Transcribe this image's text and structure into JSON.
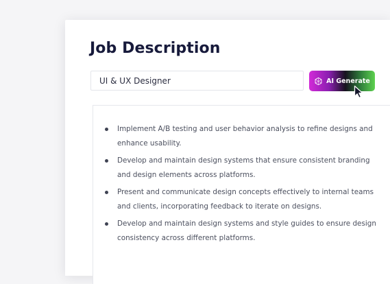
{
  "page": {
    "title": "Job Description"
  },
  "job_title_input": {
    "value": "UI & UX Designer"
  },
  "ai_button": {
    "label": "AI Generate",
    "icon": "openai-icon"
  },
  "cursor": {
    "icon": "mouse-pointer-icon"
  },
  "description": {
    "bullets": [
      "Implement A/B testing and user behavior analysis to refine designs and enhance usability.",
      "Develop and maintain design systems that ensure consistent branding and design elements across platforms.",
      "Present and communicate design concepts effectively to internal teams and clients, incorporating feedback to iterate on designs.",
      "Develop and maintain design systems and style guides to ensure design consistency across different platforms."
    ]
  },
  "colors": {
    "title": "#171a3b",
    "button_gradient_start": "#d22ad8",
    "button_gradient_end": "#5ed24f",
    "body_text": "#4b4f5e"
  }
}
